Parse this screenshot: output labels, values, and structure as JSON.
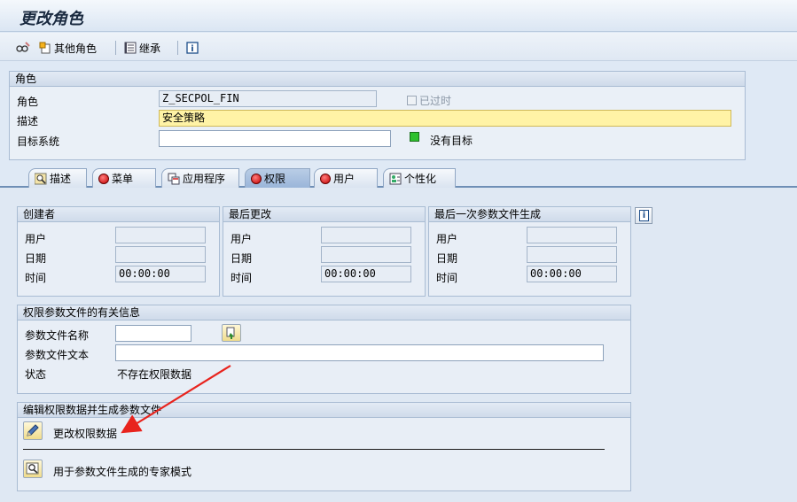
{
  "window": {
    "title": "更改角色"
  },
  "toolbar": {
    "other_role": "其他角色",
    "inherit": "继承"
  },
  "role_group": {
    "title": "角色",
    "role_label": "角色",
    "role_value": "Z_SECPOL_FIN",
    "outdated_label": "已过时",
    "desc_label": "描述",
    "desc_value": "安全策略",
    "target_label": "目标系统",
    "target_value": "",
    "no_target_label": "没有目标"
  },
  "tabs": [
    {
      "label": "描述"
    },
    {
      "label": "菜单"
    },
    {
      "label": "应用程序"
    },
    {
      "label": "权限"
    },
    {
      "label": "用户"
    },
    {
      "label": "个性化"
    }
  ],
  "creator": {
    "title": "创建者",
    "user_label": "用户",
    "date_label": "日期",
    "time_label": "时间",
    "user": "",
    "date": "",
    "time": "00:00:00"
  },
  "last_change": {
    "title": "最后更改",
    "user_label": "用户",
    "date_label": "日期",
    "time_label": "时间",
    "user": "",
    "date": "",
    "time": "00:00:00"
  },
  "last_profile_gen": {
    "title": "最后一次参数文件生成",
    "user_label": "用户",
    "date_label": "日期",
    "time_label": "时间",
    "user": "",
    "date": "",
    "time": "00:00:00"
  },
  "profile_info": {
    "title": "权限参数文件的有关信息",
    "name_label": "参数文件名称",
    "name_value": "",
    "text_label": "参数文件文本",
    "text_value": "",
    "status_label": "状态",
    "status_value": "不存在权限数据"
  },
  "edit_group": {
    "title": "编辑权限数据并生成参数文件",
    "change_label": "更改权限数据",
    "expert_label": "用于参数文件生成的专家模式"
  },
  "colors": {
    "arrow": "#e8231d",
    "highlight": "#fff3a6"
  }
}
